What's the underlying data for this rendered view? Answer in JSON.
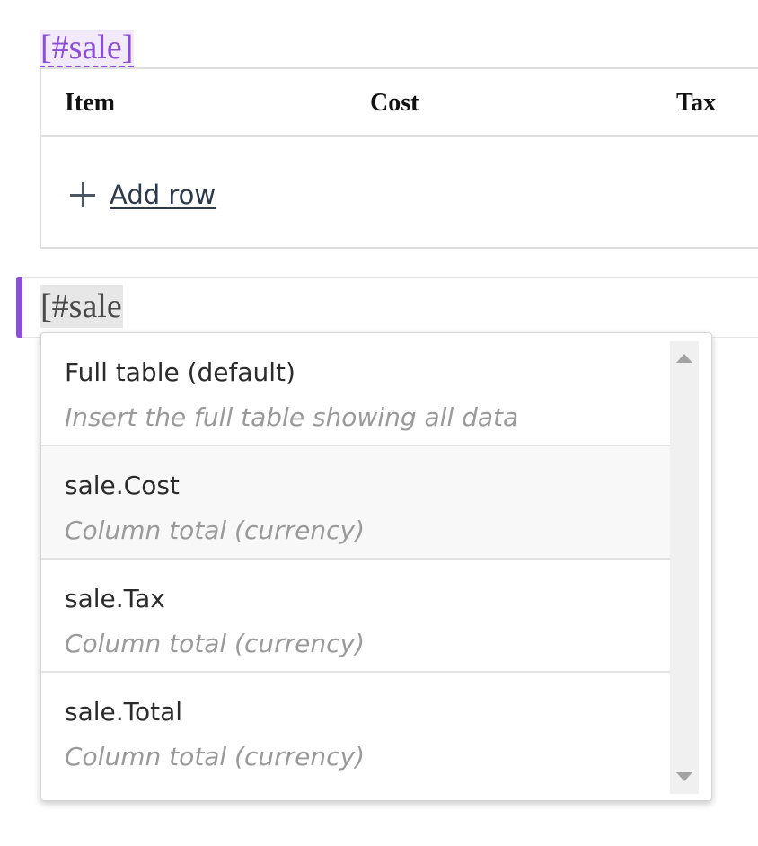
{
  "table_tag": {
    "text": "[#sale]"
  },
  "table": {
    "columns": [
      "Item",
      "Cost",
      "Tax"
    ],
    "add_row_label": "Add row"
  },
  "editor": {
    "current_text": "[#sale",
    "accent_color": "#8a4fd6"
  },
  "dropdown": {
    "highlighted_index": 1,
    "options": [
      {
        "title": "Full table (default)",
        "description": "Insert the full table showing all data"
      },
      {
        "title": "sale.Cost",
        "description": "Column total (currency)"
      },
      {
        "title": "sale.Tax",
        "description": "Column total (currency)"
      },
      {
        "title": "sale.Total",
        "description": "Column total (currency)"
      }
    ]
  },
  "icons": {
    "add": "plus-icon",
    "scroll_up": "chevron-up-icon",
    "scroll_down": "chevron-down-icon"
  }
}
